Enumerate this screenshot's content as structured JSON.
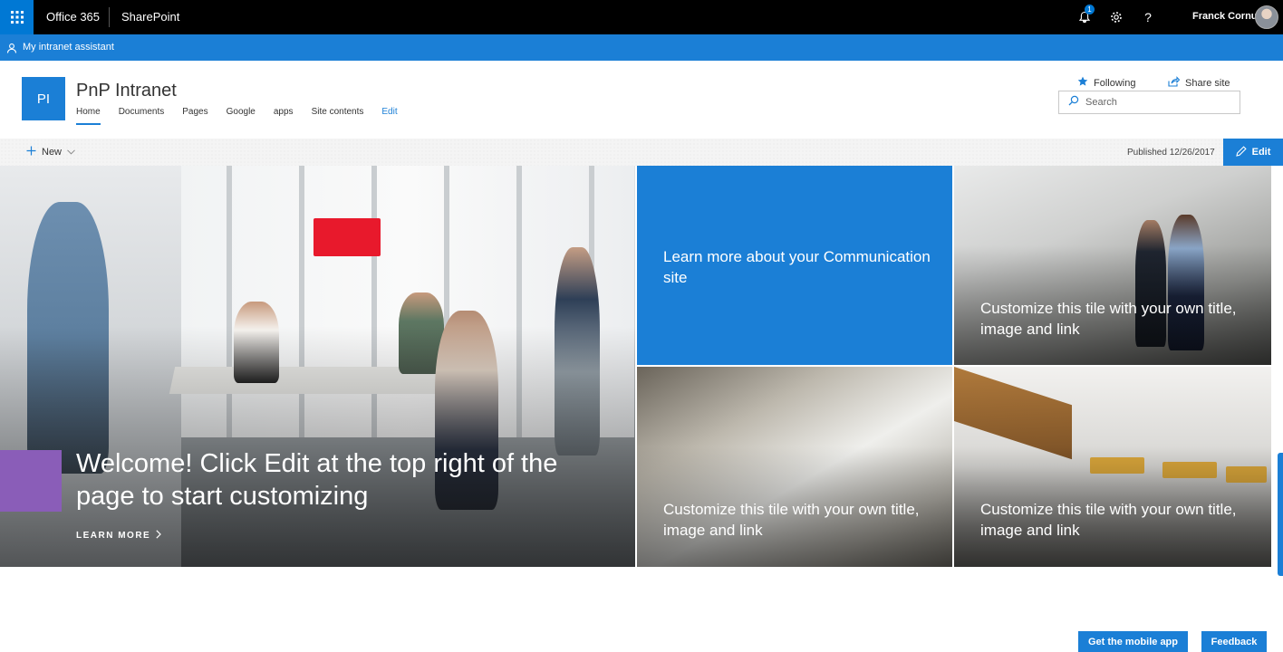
{
  "suite_bar": {
    "product": "Office 365",
    "app": "SharePoint",
    "notification_count": "1",
    "user_name": "Franck Cornu",
    "icons": [
      "waffle-icon",
      "bell-icon",
      "gear-icon",
      "help-icon"
    ]
  },
  "app_bar": {
    "assistant_label": "My intranet assistant"
  },
  "site": {
    "logo_initials": "PI",
    "title": "PnP Intranet",
    "nav": [
      {
        "label": "Home",
        "active": true
      },
      {
        "label": "Documents"
      },
      {
        "label": "Pages"
      },
      {
        "label": "Google"
      },
      {
        "label": "apps"
      },
      {
        "label": "Site contents"
      },
      {
        "label": "Edit"
      }
    ],
    "following_label": "Following",
    "share_label": "Share site",
    "search_placeholder": "Search"
  },
  "command_bar": {
    "new_label": "New",
    "published_text": "Published 12/26/2017",
    "edit_label": "Edit"
  },
  "hero": {
    "main_title": "Welcome! Click Edit at the top right of the page to start customizing",
    "learn_more": "LEARN MORE",
    "tiles": [
      {
        "text": "Learn more about your Communication site"
      },
      {
        "text": "Customize this tile with your own title, image and link"
      },
      {
        "text": "Customize this tile with your own title, image and link"
      },
      {
        "text": "Customize this tile with your own title, image and link"
      }
    ]
  },
  "footer": {
    "mobile_app_label": "Get the mobile app",
    "feedback_label": "Feedback"
  },
  "colors": {
    "brand_blue": "#1b7fd6",
    "suite_black": "#000000",
    "accent_purple": "#8a5db8"
  }
}
